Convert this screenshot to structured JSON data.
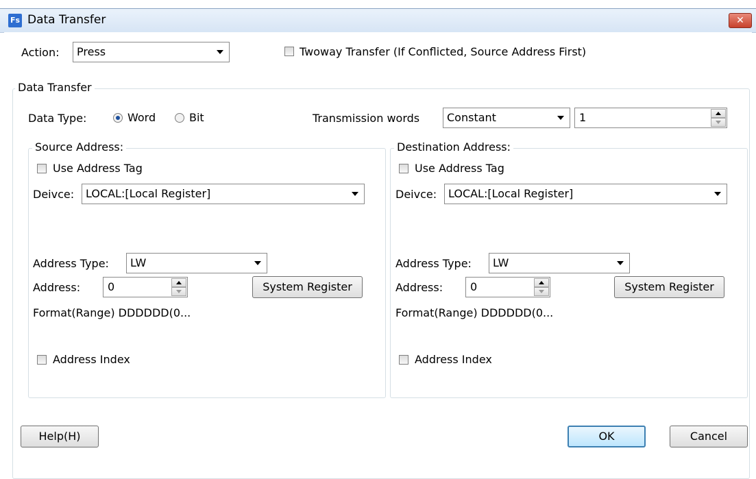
{
  "window": {
    "title": "Data Transfer",
    "icon_text": "Fs",
    "close_glyph": "✕"
  },
  "action": {
    "label": "Action:",
    "value": "Press"
  },
  "twoway": {
    "label": "Twoway Transfer (If Conflicted, Source Address First)",
    "checked": false
  },
  "data_transfer_group": {
    "legend": "Data Transfer",
    "data_type_label": "Data Type:",
    "radio_word": "Word",
    "radio_bit": "Bit",
    "selected": "Word",
    "transmission_label": "Transmission words",
    "transmission_mode": "Constant",
    "transmission_value": "1"
  },
  "source": {
    "legend": "Source Address:",
    "use_tag_label": "Use Address Tag",
    "device_label": "Deivce:",
    "device_value": "LOCAL:[Local Register]",
    "address_type_label": "Address Type:",
    "address_type_value": "LW",
    "address_label": "Address:",
    "address_value": "0",
    "system_register_label": "System Register",
    "format_text": "Format(Range) DDDDDD(0...",
    "address_index_label": "Address Index"
  },
  "destination": {
    "legend": "Destination Address:",
    "use_tag_label": "Use Address Tag",
    "device_label": "Deivce:",
    "device_value": "LOCAL:[Local Register]",
    "address_type_label": "Address Type:",
    "address_type_value": "LW",
    "address_label": "Address:",
    "address_value": "0",
    "system_register_label": "System Register",
    "format_text": "Format(Range) DDDDDD(0...",
    "address_index_label": "Address Index"
  },
  "footer": {
    "help_label": "Help(H)",
    "ok_label": "OK",
    "cancel_label": "Cancel"
  },
  "colors": {
    "titlebar": "#d7e5f5",
    "close_button": "#c7412c",
    "default_button_border": "#3c7fb1",
    "group_border": "#d5dfe5"
  }
}
